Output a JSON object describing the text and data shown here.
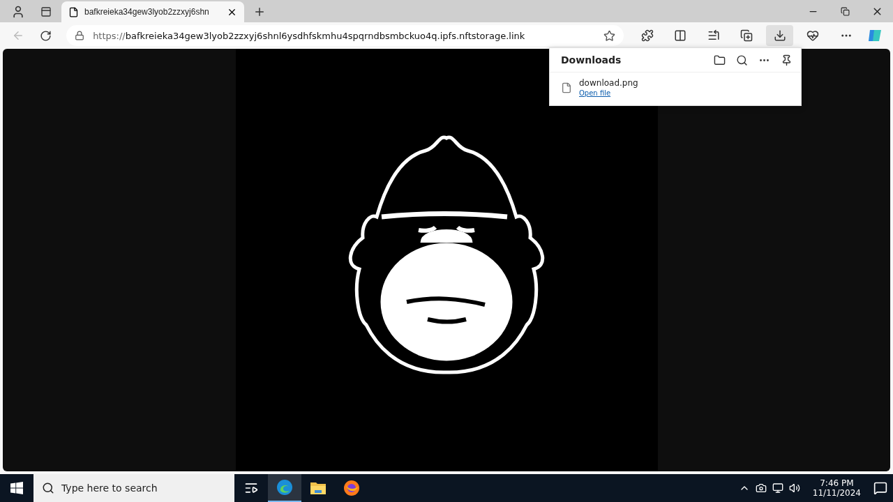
{
  "tab": {
    "title": "bafkreieka34gew3lyob2zzxyj6shn",
    "selected": true
  },
  "address": {
    "scheme": "https://",
    "rest": "bafkreieka34gew3lyob2zzxyj6shnl6ysdhfskmhu4spqrndbsmbckuo4q.ipfs.nftstorage.link"
  },
  "toolbar": [
    {
      "kind": "extensions",
      "selected": false
    },
    {
      "kind": "split",
      "selected": false
    },
    {
      "kind": "favorites",
      "selected": false
    },
    {
      "kind": "collections",
      "selected": false
    },
    {
      "kind": "downloads",
      "selected": true
    },
    {
      "kind": "health",
      "selected": false
    },
    {
      "kind": "more",
      "selected": false
    }
  ],
  "downloads": {
    "title": "Downloads",
    "items": [
      {
        "name": "download.png",
        "action": "Open file"
      }
    ]
  },
  "taskbar": {
    "search_placeholder": "Type here to search",
    "apps": [
      {
        "kind": "taskview",
        "selected": false
      },
      {
        "kind": "edge",
        "selected": true
      },
      {
        "kind": "explorer",
        "selected": false
      },
      {
        "kind": "firefox",
        "selected": false
      }
    ],
    "time": "7:46 PM",
    "date": "11/11/2024"
  }
}
